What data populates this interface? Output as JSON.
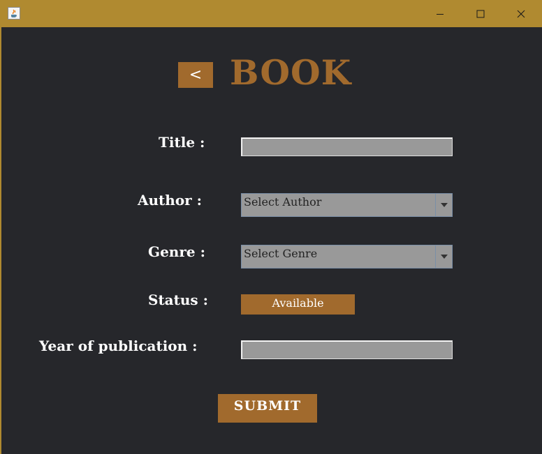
{
  "window": {
    "icon": "java-icon",
    "controls": [
      "minimize-icon",
      "maximize-icon",
      "close-icon"
    ]
  },
  "header": {
    "back_label": "<",
    "title": "BOOK"
  },
  "form": {
    "title_label": "Title :",
    "title_value": "",
    "author_label": "Author :",
    "author_selected": "Select Author",
    "genre_label": "Genre :",
    "genre_selected": "Select Genre",
    "status_label": "Status :",
    "status_value": "Available",
    "year_label": "Year of publication :",
    "year_value": "",
    "submit_label": "SUBMIT"
  },
  "colors": {
    "titlebar": "#b08a30",
    "background": "#26272b",
    "accent": "#a16a2d",
    "field": "#999999"
  }
}
